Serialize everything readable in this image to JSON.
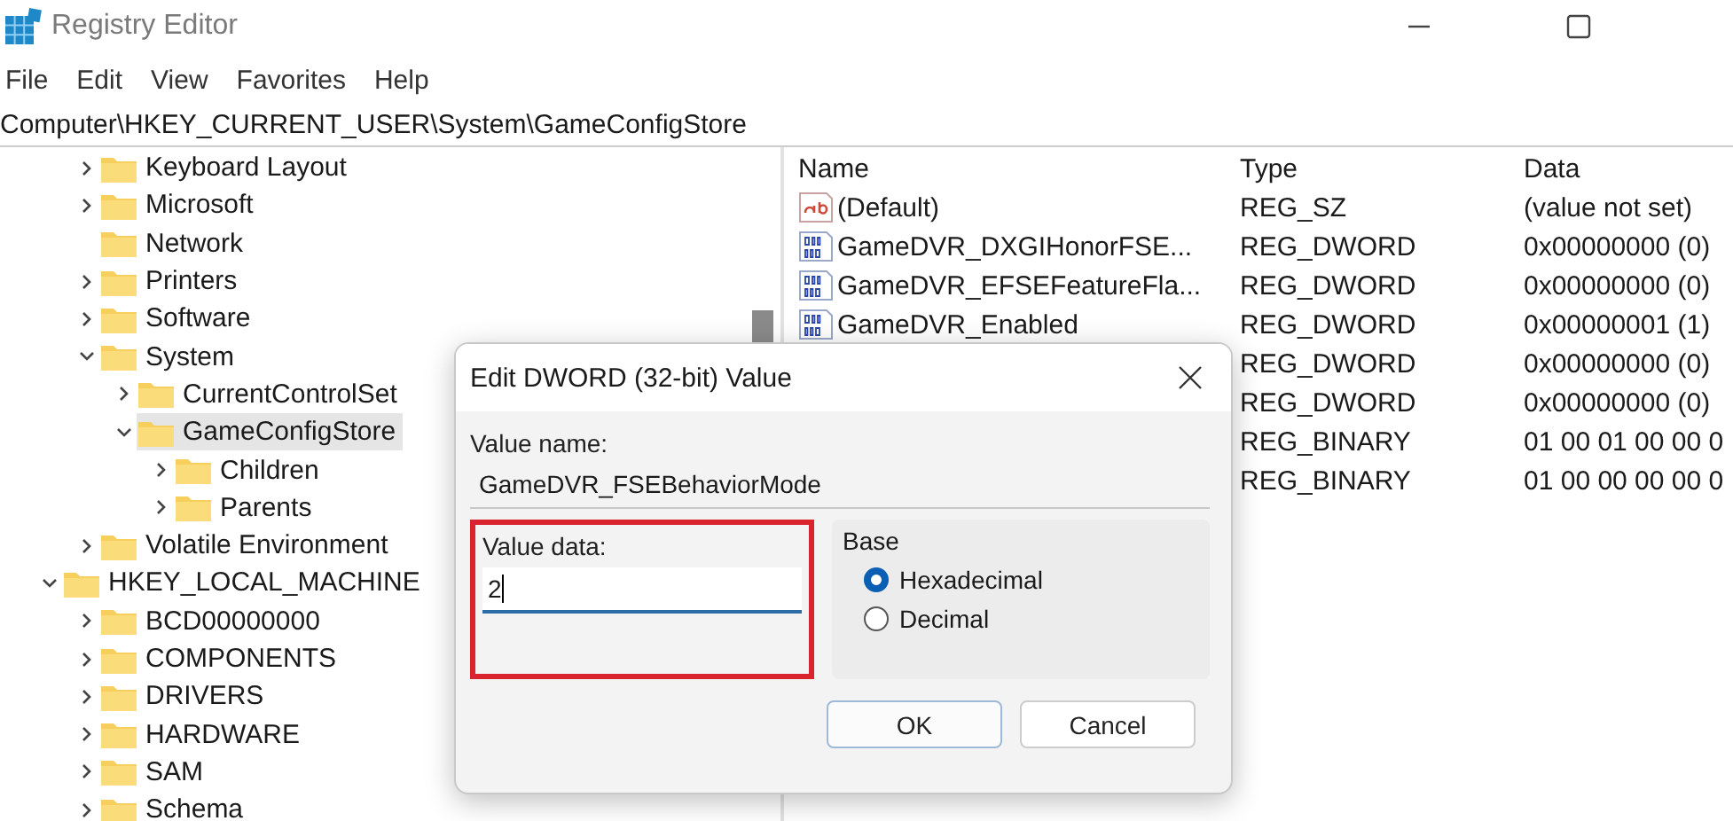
{
  "window": {
    "title": "Registry Editor"
  },
  "menu": [
    "File",
    "Edit",
    "View",
    "Favorites",
    "Help"
  ],
  "address": "Computer\\HKEY_CURRENT_USER\\System\\GameConfigStore",
  "tree": {
    "nodes": [
      {
        "children": [
          {
            "label": "Keyboard Layout",
            "expandable": true,
            "expanded": false,
            "selected": false
          },
          {
            "label": "Microsoft",
            "expandable": true,
            "expanded": false,
            "selected": false
          },
          {
            "label": "Network",
            "expandable": false,
            "selected": false
          },
          {
            "label": "Printers",
            "expandable": true,
            "expanded": false,
            "selected": false
          },
          {
            "label": "Software",
            "expandable": true,
            "expanded": false,
            "selected": false
          },
          {
            "label": "System",
            "expandable": true,
            "expanded": true,
            "selected": false,
            "children": [
              {
                "label": "CurrentControlSet",
                "expandable": true,
                "expanded": false,
                "selected": false
              },
              {
                "label": "GameConfigStore",
                "expandable": true,
                "expanded": true,
                "selected": true,
                "children": [
                  {
                    "label": "Children",
                    "expandable": true,
                    "expanded": false,
                    "selected": false
                  },
                  {
                    "label": "Parents",
                    "expandable": true,
                    "expanded": false,
                    "selected": false
                  }
                ]
              }
            ]
          },
          {
            "label": "Volatile Environment",
            "expandable": true,
            "expanded": false,
            "selected": false
          }
        ]
      },
      {
        "label": "HKEY_LOCAL_MACHINE",
        "expandable": true,
        "expanded": true,
        "selected": false,
        "children": [
          {
            "label": "BCD00000000",
            "expandable": true,
            "expanded": false,
            "selected": false
          },
          {
            "label": "COMPONENTS",
            "expandable": true,
            "expanded": false,
            "selected": false
          },
          {
            "label": "DRIVERS",
            "expandable": true,
            "expanded": false,
            "selected": false
          },
          {
            "label": "HARDWARE",
            "expandable": true,
            "expanded": false,
            "selected": false
          },
          {
            "label": "SAM",
            "expandable": true,
            "expanded": false,
            "selected": false
          },
          {
            "label": "Schema",
            "expandable": true,
            "expanded": false,
            "selected": false
          }
        ]
      }
    ]
  },
  "values": {
    "columns": [
      "Name",
      "Type",
      "Data"
    ],
    "rows": [
      {
        "kind": "string",
        "name": "(Default)",
        "type": "REG_SZ",
        "data": "(value not set)"
      },
      {
        "kind": "binary",
        "name": "GameDVR_DXGIHonorFSE...",
        "type": "REG_DWORD",
        "data": "0x00000000 (0)"
      },
      {
        "kind": "binary",
        "name": "GameDVR_EFSEFeatureFla...",
        "type": "REG_DWORD",
        "data": "0x00000000 (0)"
      },
      {
        "kind": "binary",
        "name": "GameDVR_Enabled",
        "type": "REG_DWORD",
        "data": "0x00000001 (1)"
      },
      {
        "type": "REG_DWORD",
        "data": "0x00000000 (0)"
      },
      {
        "type": "REG_DWORD",
        "data": "0x00000000 (0)"
      },
      {
        "type": "REG_BINARY",
        "data": "01 00 01 00 00 0"
      },
      {
        "type": "REG_BINARY",
        "data": "01 00 00 00 00 0"
      }
    ]
  },
  "dialog": {
    "title": "Edit DWORD (32-bit) Value",
    "value_name_label": "Value name:",
    "value_name": "GameDVR_FSEBehaviorMode",
    "value_data_label": "Value data:",
    "value_data": "2",
    "value_data_highlighted": true,
    "base": {
      "label": "Base",
      "options": [
        {
          "label": "Hexadecimal",
          "selected": true
        },
        {
          "label": "Decimal",
          "selected": false
        }
      ]
    },
    "buttons": [
      {
        "label": "OK",
        "default": true
      },
      {
        "label": "Cancel",
        "default": false
      }
    ]
  }
}
